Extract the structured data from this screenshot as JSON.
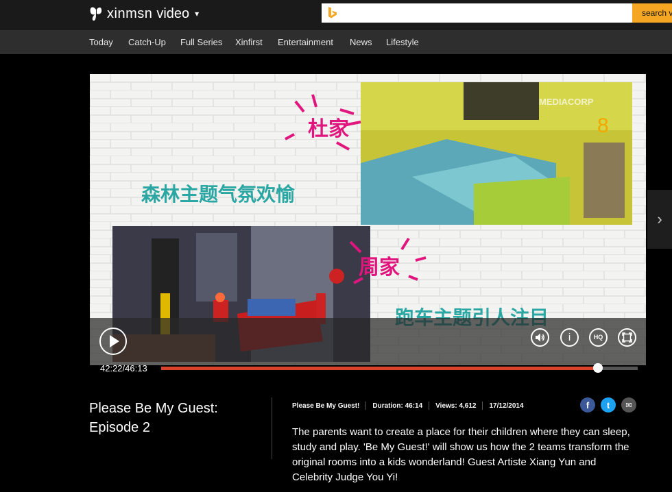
{
  "header": {
    "brand": "xinmsn",
    "section": "video",
    "section_chevron": "▾",
    "search_placeholder": "",
    "search_button": "search v"
  },
  "nav": {
    "items": [
      {
        "label": "Today"
      },
      {
        "label": "Catch-Up"
      },
      {
        "label": "Full Series"
      },
      {
        "label": "Xinfirst"
      },
      {
        "label": "Entertainment"
      },
      {
        "label": "News"
      },
      {
        "label": "Lifestyle"
      }
    ]
  },
  "player": {
    "overlay_text_1": "杜家",
    "overlay_text_2": "森林主题气氛欢愉",
    "overlay_text_3": "周家",
    "overlay_text_4": "跑车主题引人注目",
    "watermark": "MEDIACORP",
    "current_time": "42:22",
    "total_time": "46:13",
    "time_display": "42:22/46:13",
    "progress": 0.917,
    "hq_label": "HQ",
    "info_label": "i",
    "next_arrow": "›"
  },
  "episode": {
    "title_line1": "Please Be My Guest:",
    "title_line2": "Episode 2",
    "show_name": "Please Be My Guest!",
    "duration": "Duration: 46:14",
    "views": "Views: 4,612",
    "date": "17/12/2014",
    "description": "The parents want to create a place for their children where they can sleep, study and play. 'Be My Guest!' will show us how the 2 teams transform the original rooms into a kids wonderland! Guest Artiste Xiang Yun and Celebrity Judge You Yi!"
  },
  "social": {
    "facebook_letter": "f",
    "twitter_letter": "t",
    "email_letter": "✉"
  },
  "colors": {
    "accent": "#f5a623",
    "progress": "#d9432b",
    "facebook": "#3b5998",
    "twitter": "#1da1f2",
    "email": "#555555"
  }
}
